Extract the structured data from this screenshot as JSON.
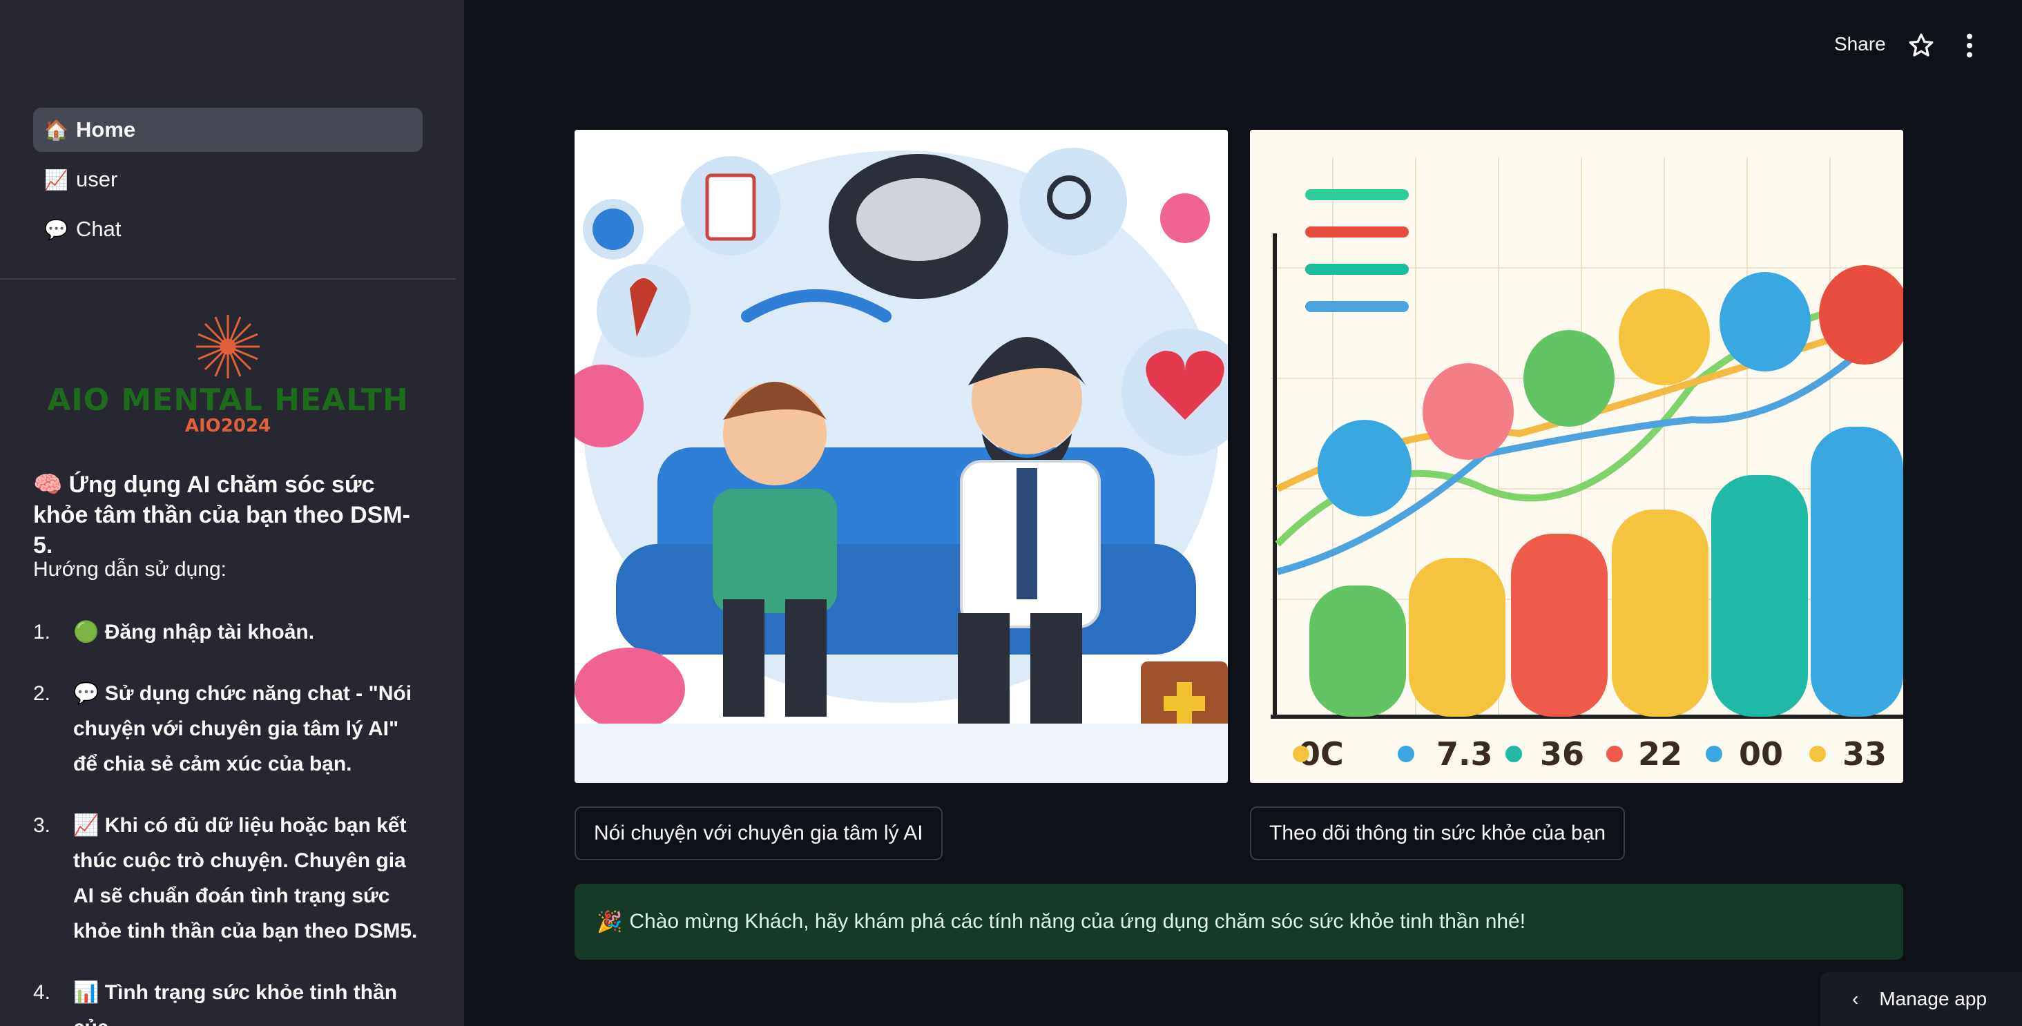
{
  "sidebar": {
    "nav": [
      {
        "icon": "🏠",
        "label": "Home",
        "active": true
      },
      {
        "icon": "📈",
        "label": "user",
        "active": false
      },
      {
        "icon": "💬",
        "label": "Chat",
        "active": false
      }
    ],
    "logo": {
      "title": "AIO MENTAL HEALTH",
      "subtitle": "AIO2024"
    },
    "intro": "🧠 Ứng dụng AI chăm sóc sức khỏe tâm thần của bạn theo DSM-5.",
    "guide_title": "Hướng dẫn sử dụng:",
    "steps": [
      {
        "num": "1.",
        "text": "🟢 Đăng nhập tài khoản."
      },
      {
        "num": "2.",
        "text": "💬 Sử dụng chức năng chat - \"Nói chuyện với chuyên gia tâm lý AI\" để chia sẻ cảm xúc của bạn."
      },
      {
        "num": "3.",
        "text": "📈 Khi có đủ dữ liệu hoặc bạn kết thúc cuộc trò chuyện. Chuyên gia AI sẽ chuẩn đoán tình trạng sức khỏe tinh thần của bạn theo DSM5."
      },
      {
        "num": "4.",
        "text": "📊 Tình trạng sức khỏe tinh thần của"
      }
    ]
  },
  "header": {
    "share_label": "Share",
    "star_icon": "star-icon",
    "menu_icon": "kebab-menu-icon"
  },
  "main": {
    "images": [
      {
        "name": "counseling-illustration"
      },
      {
        "name": "health-chart-illustration",
        "labels": [
          "0C",
          "7.3",
          "36",
          "22",
          "00",
          "33"
        ]
      }
    ],
    "buttons": [
      {
        "label": "Nói chuyện với chuyên gia tâm lý AI"
      },
      {
        "label": "Theo dõi thông tin sức khỏe của bạn"
      }
    ],
    "success": {
      "icon": "🎉",
      "text": "Chào mừng Khách, hãy khám phá các tính năng của ứng dụng chăm sóc sức khỏe tinh thần nhé!"
    }
  },
  "footer": {
    "manage_label": "Manage app"
  },
  "colors": {
    "background": "#0e1117",
    "sidebar": "#262730",
    "success_bg": "#173928",
    "logo_green": "#1e6b1e",
    "logo_orange": "#e0603a"
  }
}
